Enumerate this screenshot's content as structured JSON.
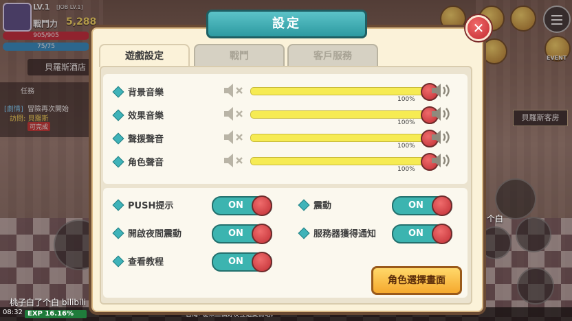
{
  "hud": {
    "level": "LV.1",
    "job": "[JOB LV.1]",
    "power_label": "戰鬥力",
    "power_value": "5,288",
    "hp": "905/905",
    "mp": "75/75",
    "location": "貝羅斯酒店",
    "quest_title": "任務",
    "quest_tag": "[劇情]",
    "quest_name": "冒險再次開始",
    "quest_visit": "訪問: 貝羅斯",
    "quest_status": "可完成",
    "inn_sign": "貝羅斯客房",
    "event_label": "EVENT",
    "time": "08:32",
    "exp": "EXP 16.16%",
    "watermark_right": "@桃子白了个白",
    "watermark_left": "桃子白了个白 bilibili",
    "chat": "台灣! 能來三個好友互送愛情站。"
  },
  "dialog": {
    "title": "設定",
    "tabs": [
      {
        "label": "遊戲設定",
        "active": true
      },
      {
        "label": "戰鬥",
        "active": false
      },
      {
        "label": "客戶服務",
        "active": false
      }
    ],
    "sliders": [
      {
        "label": "背景音樂",
        "value": 100,
        "value_text": "100%"
      },
      {
        "label": "效果音樂",
        "value": 100,
        "value_text": "100%"
      },
      {
        "label": "聲援聲音",
        "value": 100,
        "value_text": "100%"
      },
      {
        "label": "角色聲音",
        "value": 100,
        "value_text": "100%"
      }
    ],
    "toggles": [
      {
        "label": "PUSH提示",
        "state": "ON"
      },
      {
        "label": "震動",
        "state": "ON"
      },
      {
        "label": "開啟夜間震動",
        "state": "ON"
      },
      {
        "label": "服務器獲得通知",
        "state": "ON"
      },
      {
        "label": "查看教程",
        "state": "ON"
      }
    ],
    "character_select_button": "角色選擇畫面"
  },
  "colors": {
    "accent_teal": "#3cb4b0",
    "slider_yellow": "#f6eb53",
    "knob_red": "#c12f35",
    "panel_cream": "#fbf2d9"
  }
}
